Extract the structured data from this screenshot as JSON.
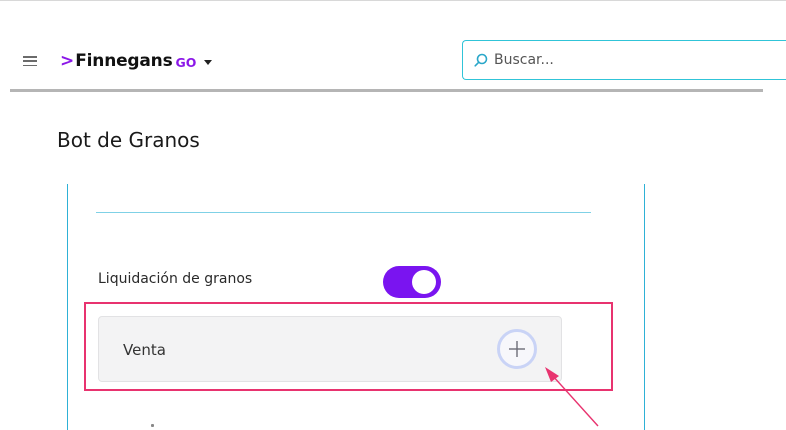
{
  "header": {
    "menu_icon": "hamburger-icon",
    "logo": {
      "chevron": ">",
      "brand": "Finnegans",
      "suffix": "GO"
    },
    "dropdown_icon": "caret-down-icon",
    "search": {
      "icon": "search-icon",
      "placeholder": "Buscar..."
    }
  },
  "page": {
    "title": "Bot de Granos"
  },
  "settings": {
    "toggle": {
      "label": "Liquidación de granos",
      "on": true
    },
    "section": {
      "label": "Venta",
      "add_icon": "plus-icon"
    }
  },
  "colors": {
    "accent_purple": "#7a14f0",
    "search_border": "#30c4d8",
    "panel_border": "#2eb1d6",
    "highlight": "#e8336f",
    "arrow": "#e8336f"
  }
}
